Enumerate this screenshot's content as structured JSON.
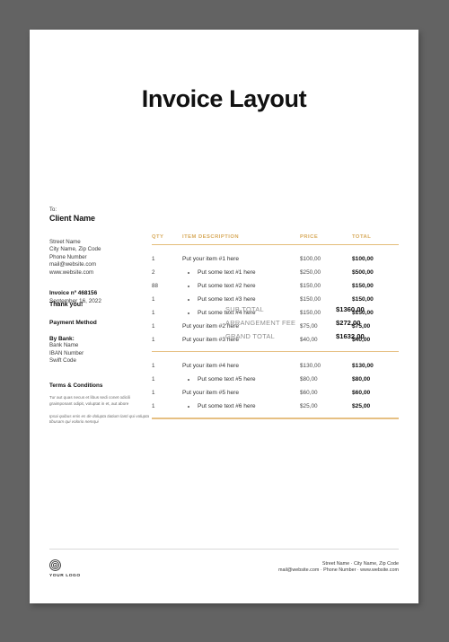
{
  "document": {
    "title": "Invoice Layout"
  },
  "client": {
    "to_label": "To:",
    "name": "Client Name",
    "address": [
      "Street Name",
      "City Name, Zip Code",
      "Phone Number",
      "mail@website.com",
      "www.website.com"
    ],
    "invoice_number": "Invoice nº 468156",
    "invoice_date": "September 16, 2022"
  },
  "payment": {
    "heading": "Payment Method",
    "bank_label": "By Bank:",
    "lines": [
      "Bank Name",
      "IBAN Number",
      "Swift Code"
    ]
  },
  "terms": {
    "heading": "Terms & Conditions",
    "paragraph1": "Tur aut quas necus et libus sedi conet odicili graimponant odipit, voluptat in et, aut abore",
    "paragraph2": "Ipsai quibus enis es de dolupta tiatium lanti qui volupta tibusam qui volorio nemqui"
  },
  "table": {
    "headers": {
      "qty": "QTY",
      "description": "ITEM DESCRIPTION",
      "price": "PRICE",
      "total": "TOTAL"
    },
    "block1": [
      {
        "qty": "1",
        "desc": "Put your item #1 here",
        "price": "$100,00",
        "total": "$100,00",
        "sub": false
      },
      {
        "qty": "2",
        "desc": "Put some text #1 here",
        "price": "$250,00",
        "total": "$500,00",
        "sub": true
      },
      {
        "qty": "88",
        "desc": "Put some text #2 here",
        "price": "$150,00",
        "total": "$150,00",
        "sub": true
      },
      {
        "qty": "1",
        "desc": "Put some text #3 here",
        "price": "$150,00",
        "total": "$150,00",
        "sub": true
      },
      {
        "qty": "1",
        "desc": "Put some text #4 here",
        "price": "$150,00",
        "total": "$150,00",
        "sub": true
      },
      {
        "qty": "1",
        "desc": "Put your item #2 here",
        "price": "$75,00",
        "total": "$75,00",
        "sub": false
      },
      {
        "qty": "1",
        "desc": "Put your item #3 here",
        "price": "$40,00",
        "total": "$40,00",
        "sub": false
      }
    ],
    "block2": [
      {
        "qty": "1",
        "desc": "Put your item #4 here",
        "price": "$130,00",
        "total": "$130,00",
        "sub": false
      },
      {
        "qty": "1",
        "desc": "Put some text #5 here",
        "price": "$80,00",
        "total": "$80,00",
        "sub": true
      },
      {
        "qty": "1",
        "desc": "Put your item #5 here",
        "price": "$60,00",
        "total": "$60,00",
        "sub": false
      },
      {
        "qty": "1",
        "desc": "Put some text #6 here",
        "price": "$25,00",
        "total": "$25,00",
        "sub": true
      }
    ]
  },
  "totals": [
    {
      "label": "SUB TOTAL",
      "value": "$1360,00"
    },
    {
      "label": "ARRANGEMENT FEE",
      "value": "$272,00"
    },
    {
      "label": "GRAND TOTAL",
      "value": "$1632,00"
    }
  ],
  "thank_you": "Thank you!",
  "footer": {
    "logo_text": "YOUR LOGO",
    "line1": "Street Name · City Name, Zip Code",
    "line2": "mail@website.com · Phone Number · www.website.com"
  },
  "colors": {
    "accent": "#e4b15c",
    "rule": "#e3bd78",
    "header_text": "#d8ab5d",
    "page_background": "#636363"
  }
}
